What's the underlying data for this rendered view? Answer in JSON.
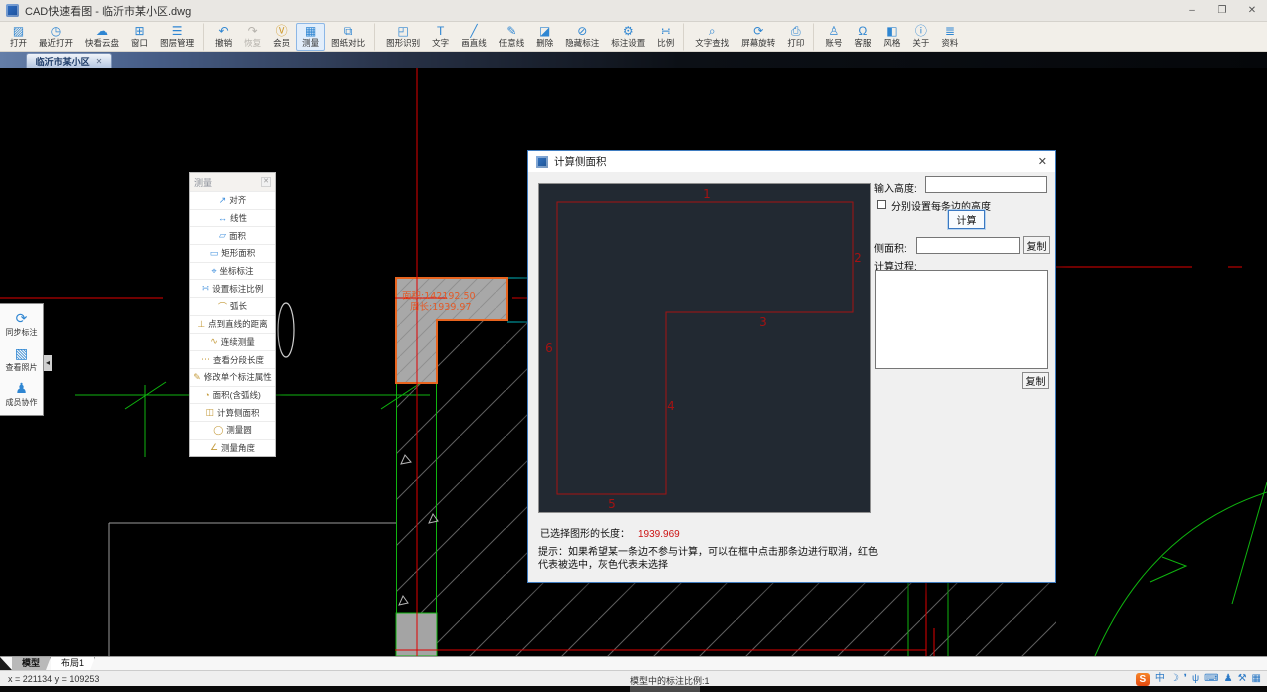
{
  "window": {
    "title": "CAD快速看图 - 临沂市某小区.dwg",
    "minimize_glyph": "–",
    "maximize_glyph": "❐",
    "close_glyph": "✕"
  },
  "toolbar": {
    "items": [
      {
        "label": "打开",
        "icon": "▨",
        "name": "toolbar-open-button"
      },
      {
        "label": "最近打开",
        "icon": "◷",
        "name": "toolbar-recent-open-button"
      },
      {
        "label": "快看云盘",
        "icon": "☁",
        "name": "toolbar-cloud-button"
      },
      {
        "label": "窗口",
        "icon": "⊞",
        "name": "toolbar-window-button"
      },
      {
        "label": "图层管理",
        "icon": "☰",
        "name": "toolbar-layer-manager-button",
        "sep_after": true
      },
      {
        "label": "撤销",
        "icon": "↶",
        "name": "toolbar-undo-button"
      },
      {
        "label": "恢复",
        "icon": "↷",
        "name": "toolbar-redo-button",
        "disabled": true
      },
      {
        "label": "会员",
        "icon": "Ⓥ",
        "name": "toolbar-vip-button",
        "gold": true
      },
      {
        "label": "测量",
        "icon": "▦",
        "name": "toolbar-measure-button",
        "selected": true
      },
      {
        "label": "图纸对比",
        "icon": "⧉",
        "name": "toolbar-drawing-compare-button",
        "sep_after": true
      },
      {
        "label": "图形识别",
        "icon": "◰",
        "name": "toolbar-shape-recognize-button"
      },
      {
        "label": "文字",
        "icon": "T",
        "name": "toolbar-text-button"
      },
      {
        "label": "画直线",
        "icon": "╱",
        "name": "toolbar-draw-line-button"
      },
      {
        "label": "任意线",
        "icon": "✎",
        "name": "toolbar-free-line-button"
      },
      {
        "label": "删除",
        "icon": "◪",
        "name": "toolbar-delete-button"
      },
      {
        "label": "隐藏标注",
        "icon": "⊘",
        "name": "toolbar-hide-annotation-button"
      },
      {
        "label": "标注设置",
        "icon": "⚙",
        "name": "toolbar-annotation-settings-button"
      },
      {
        "label": "比例",
        "icon": "∺",
        "name": "toolbar-scale-button",
        "sep_after": true
      },
      {
        "label": "文字查找",
        "icon": "⌕",
        "name": "toolbar-text-search-button"
      },
      {
        "label": "屏幕旋转",
        "icon": "⟳",
        "name": "toolbar-screen-rotate-button"
      },
      {
        "label": "打印",
        "icon": "⎙",
        "name": "toolbar-print-button",
        "sep_after": true
      },
      {
        "label": "账号",
        "icon": "♙",
        "name": "toolbar-account-button"
      },
      {
        "label": "客服",
        "icon": "Ω",
        "name": "toolbar-support-button"
      },
      {
        "label": "风格",
        "icon": "◧",
        "name": "toolbar-style-button"
      },
      {
        "label": "关于",
        "icon": "ⓘ",
        "name": "toolbar-about-button"
      },
      {
        "label": "资料",
        "icon": "≣",
        "name": "toolbar-docs-button"
      }
    ]
  },
  "doc_tab": {
    "label": "临沂市某小区",
    "close_glyph": "✕"
  },
  "side_dock": {
    "items": [
      {
        "label": "同步标注",
        "icon": "⟳",
        "name": "dock-sync-annotation-button"
      },
      {
        "label": "查看照片",
        "icon": "▧",
        "name": "dock-view-photos-button"
      },
      {
        "label": "成员协作",
        "icon": "♟",
        "name": "dock-member-collab-button"
      }
    ],
    "collapse_glyph": "◂"
  },
  "measure_panel": {
    "title": "测量",
    "close_glyph": "✕",
    "items": [
      {
        "label": "对齐",
        "icon": "↗",
        "name": "measure-align"
      },
      {
        "label": "线性",
        "icon": "↔",
        "name": "measure-linear"
      },
      {
        "label": "面积",
        "icon": "▱",
        "name": "measure-area"
      },
      {
        "label": "矩形面积",
        "icon": "▭",
        "name": "measure-rect-area"
      },
      {
        "label": "坐标标注",
        "icon": "⌖",
        "name": "measure-coordinate-dim"
      },
      {
        "label": "设置标注比例",
        "icon": "∺",
        "name": "measure-set-dim-scale"
      },
      {
        "label": "弧长",
        "icon": "⌒",
        "name": "measure-arc-length",
        "gold": true
      },
      {
        "label": "点到直线的距离",
        "icon": "⊥",
        "name": "measure-point-line-distance",
        "gold": true
      },
      {
        "label": "连续测量",
        "icon": "∿",
        "name": "measure-continuous",
        "gold": true
      },
      {
        "label": "查看分段长度",
        "icon": "⋯",
        "name": "measure-segment-length",
        "gold": true
      },
      {
        "label": "修改单个标注属性",
        "icon": "✎",
        "name": "measure-edit-dim-attr",
        "gold": true
      },
      {
        "label": "面积(含弧线)",
        "icon": "◔",
        "name": "measure-area-with-arc",
        "gold": true
      },
      {
        "label": "计算侧面积",
        "icon": "◫",
        "name": "measure-calc-side-area",
        "gold": true
      },
      {
        "label": "测量圆",
        "icon": "◯",
        "name": "measure-circle",
        "gold": true
      },
      {
        "label": "测量角度",
        "icon": "∠",
        "name": "measure-angle",
        "gold": true
      }
    ]
  },
  "cad": {
    "area_text": "面积:142192.50",
    "perimeter_text": "周长:1939.97"
  },
  "dialog": {
    "title": "计算侧面积",
    "close_glyph": "✕",
    "height_label": "输入高度:",
    "height_value": "",
    "per_edge_checkbox_label": "分别设置每条边的高度",
    "calc_button_label": "计算",
    "side_area_label": "侧面积:",
    "side_area_value": "",
    "copy_button_label": "复制",
    "process_label": "计算过程:",
    "process_value": "",
    "selected_length_label": "已选择图形的长度：",
    "selected_length_value": "1939.969",
    "hint": "提示：如果希望某一条边不参与计算，可以在框中点击那条边进行取消，红色代表被选中，灰色代表未选择",
    "edge_labels": [
      "1",
      "2",
      "3",
      "4",
      "5",
      "6"
    ]
  },
  "layout_tabs": {
    "model": "模型",
    "layout": "布局1"
  },
  "statusbar": {
    "coords": "x = 221134  y = 109253",
    "scale_info": "模型中的标注比例:1"
  },
  "tray": {
    "sogou_logo": "S",
    "icons": [
      {
        "glyph": "中",
        "name": "ime-lang-chinese-icon"
      },
      {
        "glyph": "☽",
        "name": "ime-night-mode-icon"
      },
      {
        "glyph": "❜",
        "name": "ime-punctuation-icon"
      },
      {
        "glyph": "ψ",
        "name": "ime-voice-icon"
      },
      {
        "glyph": "⌨",
        "name": "ime-keyboard-icon"
      },
      {
        "glyph": "♟",
        "name": "ime-account-icon"
      },
      {
        "glyph": "⚒",
        "name": "ime-toolbox-icon"
      },
      {
        "glyph": "▦",
        "name": "ime-grid-icon"
      }
    ]
  },
  "colors": {
    "accent_blue": "#2f86d2",
    "vip_gold": "#c9972f",
    "selection_red": "#cc1212",
    "highlight_orange": "#e8641f",
    "cad_green": "#0fb40f",
    "cad_cyan": "#00b8c0"
  }
}
